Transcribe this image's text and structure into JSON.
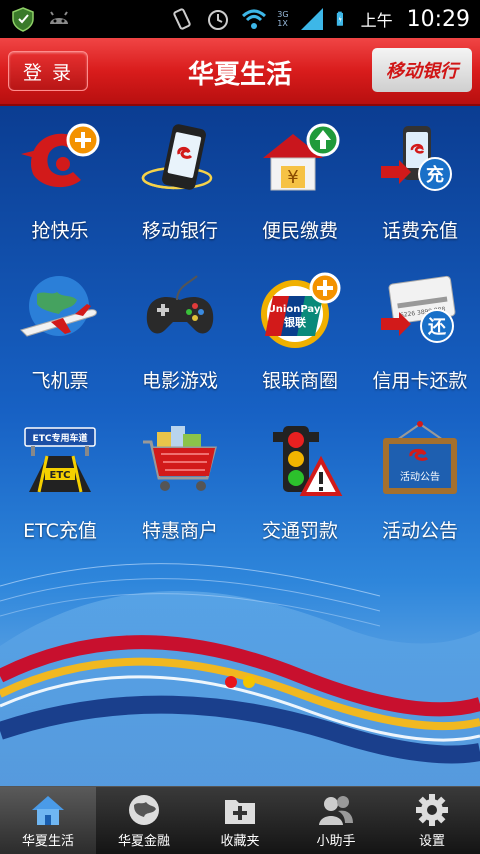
{
  "status_bar": {
    "ampm": "上午",
    "time": "10:29",
    "network": [
      "3G",
      "1X"
    ],
    "icons": [
      "shield-icon",
      "android-icon",
      "vibrate-icon",
      "alarm-icon",
      "wifi-icon",
      "signal-icon",
      "battery-icon"
    ]
  },
  "header": {
    "login_label": "登 录",
    "title": "华夏生活",
    "mobile_bank_label": "移动银行",
    "accent_color": "#d91c1c"
  },
  "grid": {
    "items": [
      {
        "label": "抢快乐",
        "icon": "happy-grab-plus-icon"
      },
      {
        "label": "移动银行",
        "icon": "mobile-phone-icon"
      },
      {
        "label": "便民缴费",
        "icon": "house-payment-upload-icon"
      },
      {
        "label": "话费充值",
        "icon": "phone-recharge-icon"
      },
      {
        "label": "飞机票",
        "icon": "airplane-globe-icon"
      },
      {
        "label": "电影游戏",
        "icon": "gamepad-icon"
      },
      {
        "label": "银联商圈",
        "icon": "unionpay-plus-icon"
      },
      {
        "label": "信用卡还款",
        "icon": "credit-card-repay-icon"
      },
      {
        "label": "ETC充值",
        "icon": "etc-lane-icon"
      },
      {
        "label": "特惠商户",
        "icon": "shopping-cart-icon"
      },
      {
        "label": "交通罚款",
        "icon": "traffic-light-warning-icon"
      },
      {
        "label": "活动公告",
        "icon": "notice-board-icon"
      }
    ],
    "icon_texts": {
      "recharge": "充",
      "repay": "还",
      "unionpay_top": "UnionPay",
      "unionpay_bottom": "银联",
      "etc_sign": "ETC专用车道",
      "etc_road": "ETC",
      "notice": "活动公告",
      "card_number": "6226 3899 888",
      "house_symbol": "¥"
    }
  },
  "pager": {
    "page_count": 2,
    "current_page": 1,
    "active_color": "#e8141b",
    "inactive_color": "#f4c400"
  },
  "bottom_nav": {
    "active_index": 0,
    "items": [
      {
        "label": "华夏生活",
        "icon": "home-icon"
      },
      {
        "label": "华夏金融",
        "icon": "globe-icon"
      },
      {
        "label": "收藏夹",
        "icon": "favorites-folder-plus-icon"
      },
      {
        "label": "小助手",
        "icon": "assistant-people-icon"
      },
      {
        "label": "设置",
        "icon": "gear-icon"
      }
    ]
  }
}
